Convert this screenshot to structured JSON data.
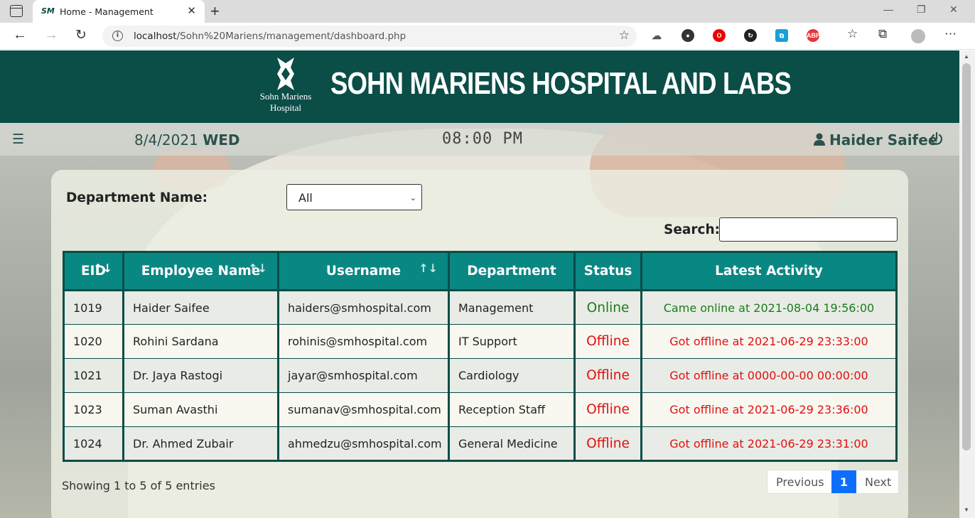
{
  "browser": {
    "tab_favicon": "SM",
    "tab_title": "Home - Management",
    "url_host": "localhost",
    "url_path": "/Sohn%20Mariens/management/dashboard.php"
  },
  "header": {
    "logo_line1": "Sohn Mariens",
    "logo_line2": "Hospital",
    "title": "SOHN MARIENS HOSPITAL AND LABS",
    "brand_color": "#0b4d47"
  },
  "infobar": {
    "date": "8/4/2021",
    "day": "WED",
    "time": "08:00 PM",
    "user_name": "Haider Saifee"
  },
  "filters": {
    "department_label": "Department Name:",
    "department_selected": "All",
    "search_label": "Search:",
    "search_value": ""
  },
  "table": {
    "columns": [
      "EID",
      "Employee Name",
      "Username",
      "Department",
      "Status",
      "Latest Activity"
    ],
    "rows": [
      {
        "eid": "1019",
        "name": "Haider Saifee",
        "username": "haiders@smhospital.com",
        "department": "Management",
        "status": "Online",
        "activity": "Came online at 2021-08-04 19:56:00"
      },
      {
        "eid": "1020",
        "name": "Rohini Sardana",
        "username": "rohinis@smhospital.com",
        "department": "IT Support",
        "status": "Offline",
        "activity": "Got offline at 2021-06-29 23:33:00"
      },
      {
        "eid": "1021",
        "name": "Dr. Jaya Rastogi",
        "username": "jayar@smhospital.com",
        "department": "Cardiology",
        "status": "Offline",
        "activity": "Got offline at 0000-00-00 00:00:00"
      },
      {
        "eid": "1023",
        "name": "Suman Avasthi",
        "username": "sumanav@smhospital.com",
        "department": "Reception Staff",
        "status": "Offline",
        "activity": "Got offline at 2021-06-29 23:36:00"
      },
      {
        "eid": "1024",
        "name": "Dr. Ahmed Zubair",
        "username": "ahmedzu@smhospital.com",
        "department": "General Medicine",
        "status": "Offline",
        "activity": "Got offline at 2021-06-29 23:31:00"
      }
    ]
  },
  "footer": {
    "showing_text": "Showing 1 to 5 of 5 entries",
    "prev_label": "Previous",
    "page_number": "1",
    "next_label": "Next"
  }
}
